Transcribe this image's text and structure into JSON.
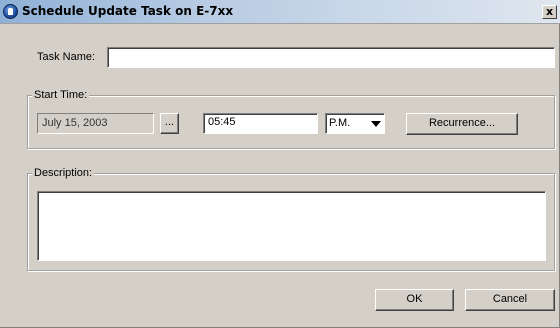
{
  "window": {
    "title": "Schedule Update Task on E-7xx",
    "close_glyph": "x"
  },
  "task": {
    "label": "Task Name:",
    "value": ""
  },
  "start_time": {
    "group_label": "Start Time:",
    "date": "July 15, 2003",
    "date_picker_label": "...",
    "time": "05:45",
    "ampm": "P.M.",
    "recurrence_label": "Recurrence..."
  },
  "description": {
    "group_label": "Description:",
    "value": ""
  },
  "footer": {
    "ok_label": "OK",
    "cancel_label": "Cancel"
  }
}
